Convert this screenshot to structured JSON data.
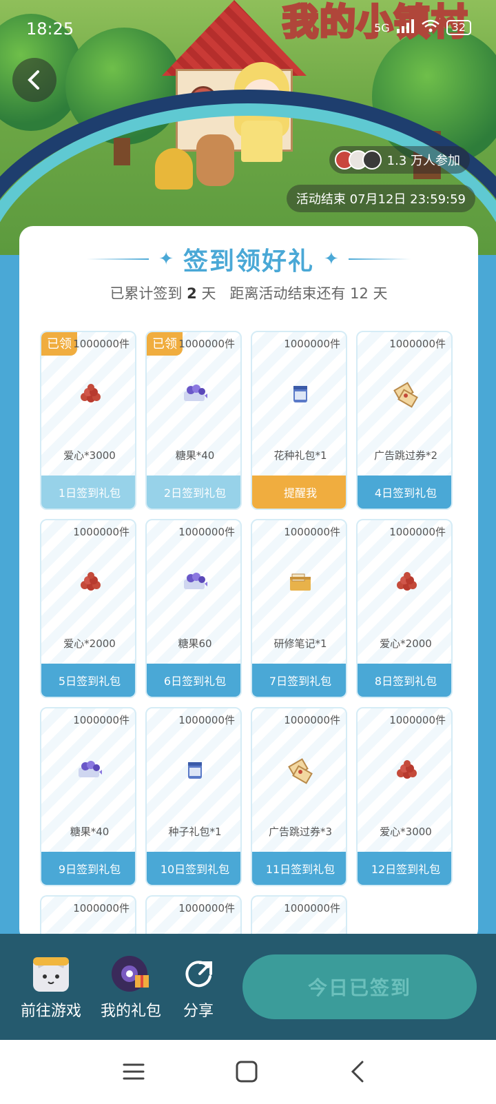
{
  "status_bar": {
    "time": "18:25",
    "network": "5G",
    "battery": "32"
  },
  "banner": {
    "title_art": "我的小镇村",
    "participants": "1.3 万人参加",
    "end_time": "活动结束 07月12日 23:59:59"
  },
  "card": {
    "title": "签到领好礼",
    "subtitle_prefix": "已累计签到",
    "days_signed": "2",
    "subtitle_days_unit": "天",
    "subtitle_middle": "距离活动结束还有 12 天"
  },
  "gifts": [
    {
      "stock": "1000000件",
      "tag": "已领",
      "name": "爱心*3000",
      "button": "1日签到礼包",
      "icon": "hearts-icon",
      "state": "claimed"
    },
    {
      "stock": "1000000件",
      "tag": "已领",
      "name": "糖果*40",
      "button": "2日签到礼包",
      "icon": "candy-icon",
      "state": "claimed"
    },
    {
      "stock": "1000000件",
      "tag": "",
      "name": "花种礼包*1",
      "button": "提醒我",
      "icon": "seed-pack-icon",
      "state": "remind"
    },
    {
      "stock": "1000000件",
      "tag": "",
      "name": "广告跳过券*2",
      "button": "4日签到礼包",
      "icon": "ticket-icon",
      "state": "normal"
    },
    {
      "stock": "1000000件",
      "tag": "",
      "name": "爱心*2000",
      "button": "5日签到礼包",
      "icon": "hearts-icon",
      "state": "normal"
    },
    {
      "stock": "1000000件",
      "tag": "",
      "name": "糖果60",
      "button": "6日签到礼包",
      "icon": "candy-icon",
      "state": "normal"
    },
    {
      "stock": "1000000件",
      "tag": "",
      "name": "研修笔记*1",
      "button": "7日签到礼包",
      "icon": "notes-icon",
      "state": "normal"
    },
    {
      "stock": "1000000件",
      "tag": "",
      "name": "爱心*2000",
      "button": "8日签到礼包",
      "icon": "hearts-icon",
      "state": "normal"
    },
    {
      "stock": "1000000件",
      "tag": "",
      "name": "糖果*40",
      "button": "9日签到礼包",
      "icon": "candy-icon",
      "state": "normal"
    },
    {
      "stock": "1000000件",
      "tag": "",
      "name": "种子礼包*1",
      "button": "10日签到礼包",
      "icon": "seed-pack-icon",
      "state": "normal"
    },
    {
      "stock": "1000000件",
      "tag": "",
      "name": "广告跳过券*3",
      "button": "11日签到礼包",
      "icon": "ticket-icon",
      "state": "normal"
    },
    {
      "stock": "1000000件",
      "tag": "",
      "name": "爱心*3000",
      "button": "12日签到礼包",
      "icon": "hearts-icon",
      "state": "normal"
    }
  ],
  "partial_gifts": [
    {
      "stock": "1000000件"
    },
    {
      "stock": "1000000件"
    },
    {
      "stock": "1000000件"
    }
  ],
  "bottom_bar": {
    "go_game": "前往游戏",
    "my_gifts": "我的礼包",
    "share": "分享",
    "signed_button": "今日已签到"
  }
}
